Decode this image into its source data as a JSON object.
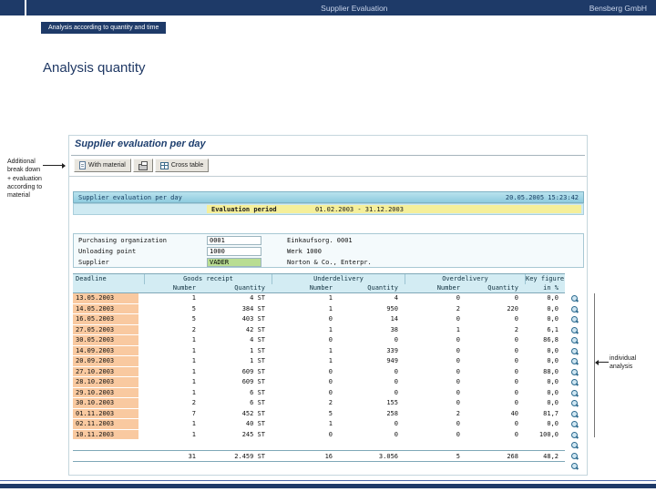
{
  "header": {
    "title": "Supplier Evaluation",
    "company": "Bensberg GmbH",
    "section_tab": "Analysis according to quantity and time"
  },
  "slide": {
    "title": "Analysis quantity",
    "left_annotation": [
      "Additional",
      "break down",
      "+ evaluation",
      "according to",
      "material"
    ],
    "right_annotation": [
      "individual",
      "analysis"
    ]
  },
  "sap": {
    "report_title": "Supplier evaluation per day",
    "toolbar": {
      "with_material_label": "With material",
      "cross_table_label": "Cross table"
    },
    "list_header": {
      "title": "Supplier evaluation per day",
      "timestamp": "20.05.2005 15:23:42"
    },
    "evaluation_period": {
      "label": "Evaluation period",
      "value": "01.02.2003 - 31.12.2003"
    },
    "filters": [
      {
        "label": "Purchasing organization",
        "value": "0001",
        "description": "Einkaufsorg. 0001"
      },
      {
        "label": "Unloading point",
        "value": "1000",
        "description": "Werk 1000"
      },
      {
        "label": "Supplier",
        "value": "VADER",
        "description": "Norton & Co., Enterpr."
      }
    ],
    "table": {
      "group_headers": [
        "Deadline",
        "Goods receipt",
        "Underdelivery",
        "Overdelivery",
        "Key figure"
      ],
      "sub_headers": [
        "",
        "Number",
        "Quantity",
        "Number",
        "Quantity",
        "Number",
        "Quantity",
        "in %"
      ],
      "rows": [
        [
          "13.05.2003",
          "1",
          "4 ST",
          "1",
          "4",
          "0",
          "0",
          "0,0"
        ],
        [
          "14.05.2003",
          "5",
          "384 ST",
          "1",
          "950",
          "2",
          "220",
          "0,0"
        ],
        [
          "16.05.2003",
          "5",
          "403 ST",
          "0",
          "14",
          "0",
          "0",
          "0,0"
        ],
        [
          "27.05.2003",
          "2",
          "42 ST",
          "1",
          "38",
          "1",
          "2",
          "6,1"
        ],
        [
          "30.05.2003",
          "1",
          "4 ST",
          "0",
          "0",
          "0",
          "0",
          "86,8"
        ],
        [
          "14.09.2003",
          "1",
          "1 ST",
          "1",
          "339",
          "0",
          "0",
          "0,0"
        ],
        [
          "20.09.2003",
          "1",
          "1 ST",
          "1",
          "949",
          "0",
          "0",
          "0,0"
        ],
        [
          "27.10.2003",
          "1",
          "609 ST",
          "0",
          "0",
          "0",
          "0",
          "88,0"
        ],
        [
          "28.10.2003",
          "1",
          "609 ST",
          "0",
          "0",
          "0",
          "0",
          "0,0"
        ],
        [
          "29.10.2003",
          "1",
          "6 ST",
          "0",
          "0",
          "0",
          "0",
          "0,0"
        ],
        [
          "30.10.2003",
          "2",
          "6 ST",
          "2",
          "155",
          "0",
          "0",
          "0,0"
        ],
        [
          "01.11.2003",
          "7",
          "452 ST",
          "5",
          "258",
          "2",
          "40",
          "81,7"
        ],
        [
          "02.11.2003",
          "1",
          "40 ST",
          "1",
          "0",
          "0",
          "0",
          "0,0"
        ],
        [
          "10.11.2003",
          "1",
          "245 ST",
          "0",
          "0",
          "0",
          "0",
          "100,0"
        ]
      ],
      "total": [
        "",
        "31",
        "2.459 ST",
        "16",
        "3.056",
        "5",
        "268",
        "48,2"
      ]
    },
    "detail_rail_count": 17,
    "icons": {
      "toolbar": [
        "document-icon",
        "printer-icon",
        "table-grid-icon"
      ],
      "row_detail": "magnifier-icon"
    }
  },
  "colors": {
    "navy": "#1e3a68",
    "titlebar_cyan": "#9fd4e4",
    "strip_cyan": "#cfeaf2",
    "header_cyan": "#d3ecf3",
    "yellow": "#f5ef9a",
    "green": "#b9dd92",
    "salmon": "#f9c9a0"
  }
}
